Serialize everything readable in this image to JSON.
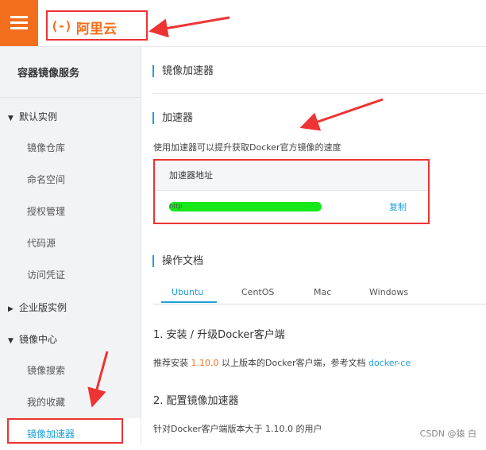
{
  "header": {
    "logo_mark": "(-)",
    "logo_text": "阿里云"
  },
  "sidebar": {
    "title": "容器镜像服务",
    "groups": [
      {
        "label": "默认实例",
        "expanded": true,
        "items": [
          "镜像仓库",
          "命名空间",
          "授权管理",
          "代码源",
          "访问凭证"
        ]
      },
      {
        "label": "企业版实例",
        "expanded": false,
        "items": []
      },
      {
        "label": "镜像中心",
        "expanded": true,
        "items": [
          "镜像搜索",
          "我的收藏",
          "镜像加速器"
        ]
      }
    ],
    "active_item": "镜像加速器"
  },
  "main": {
    "page_title": "镜像加速器",
    "accelerator": {
      "title": "加速器",
      "description": "使用加速器可以提升获取Docker官方镜像的速度",
      "address_header": "加速器地址",
      "address_value": "http",
      "copy_label": "复制"
    },
    "docs": {
      "title": "操作文档",
      "tabs": [
        "Ubuntu",
        "CentOS",
        "Mac",
        "Windows"
      ],
      "active_tab": "Ubuntu",
      "step1_title": "1. 安装 / 升级Docker客户端",
      "step1_text_a": "推荐安装 ",
      "step1_version": "1.10.0",
      "step1_text_b": " 以上版本的Docker客户端，参考文档 ",
      "step1_link": "docker-ce",
      "step2_title": "2. 配置镜像加速器",
      "step2_text": "针对Docker客户端版本大于 1.10.0 的用户"
    }
  },
  "watermark": "CSDN @猿 白",
  "colors": {
    "accent": "#1f9fd8",
    "brand": "#f36f1e",
    "annotation": "#e33333",
    "redaction": "#17e81a"
  }
}
